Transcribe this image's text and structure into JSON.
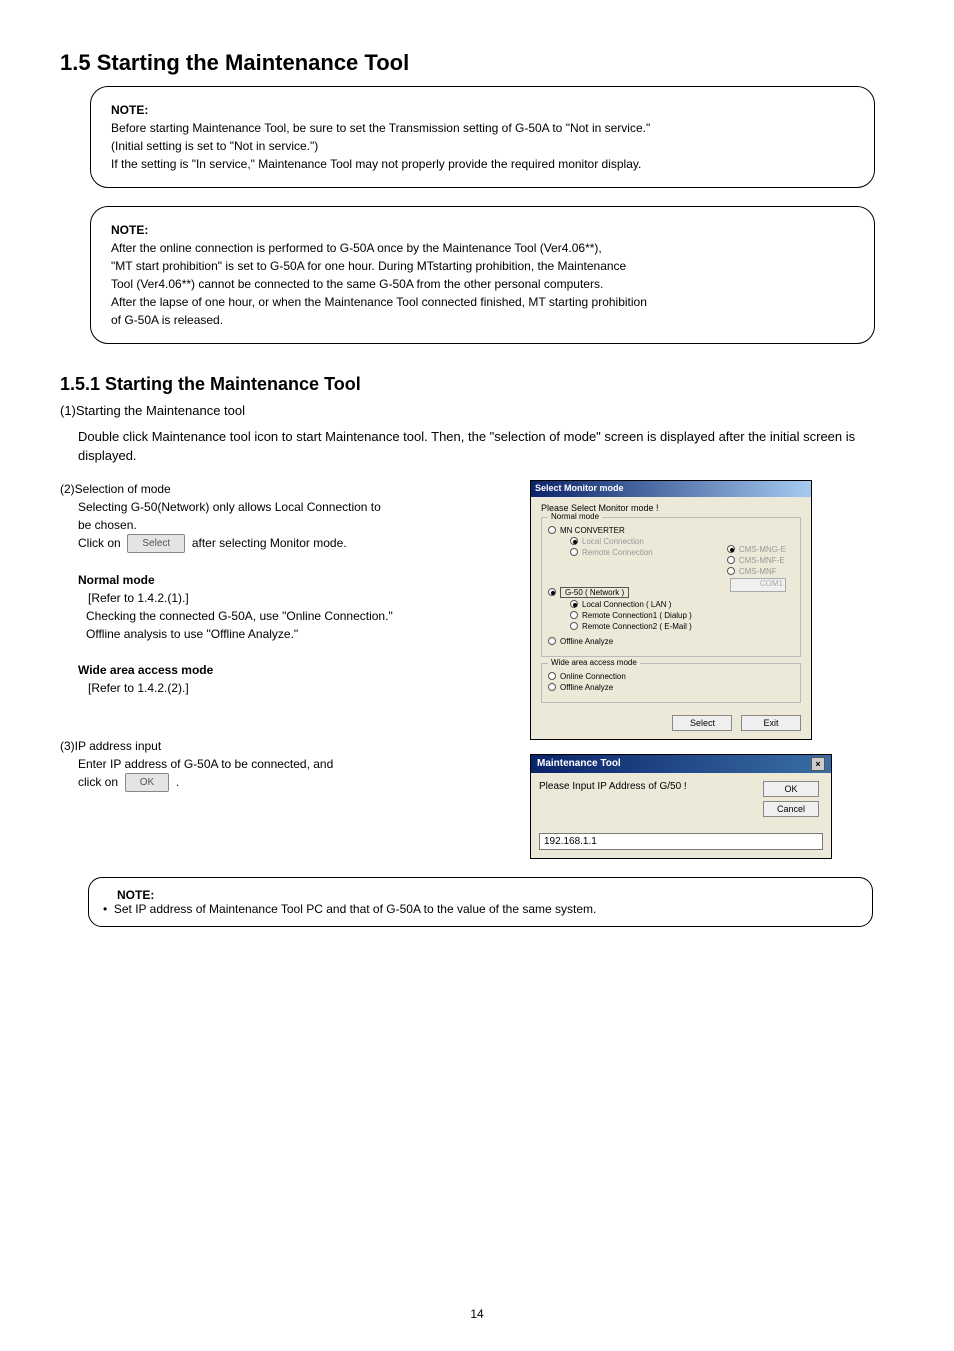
{
  "section_heading": "1.5 Starting the Maintenance Tool",
  "note1": {
    "title": "NOTE:",
    "lines": [
      "Before starting Maintenance Tool, be sure to set the Transmission setting of G-50A to \"Not in service.\"",
      "(Initial setting is set to \"Not in service.\")",
      "If the setting is \"In service,\" Maintenance Tool may not properly provide the required monitor display."
    ]
  },
  "note2": {
    "title": "NOTE:",
    "lines": [
      "After the online connection is performed to G-50A once by the Maintenance Tool (Ver4.06**),",
      "\"MT start prohibition\" is set to G-50A for one hour. During MTstarting prohibition, the Maintenance",
      "Tool (Ver4.06**) cannot be connected to the same G-50A from the other personal computers.",
      "After the lapse of one hour, or when the Maintenance Tool connected finished, MT starting prohibition",
      "of G-50A is released."
    ]
  },
  "sub_heading": "1.5.1 Starting the Maintenance Tool",
  "intro_line": "(1)Starting the Maintenance tool",
  "intro_text": "Double click Maintenance tool icon to start Maintenance tool. Then, the \"selection of mode\" screen is displayed after the initial screen is displayed.",
  "step2_heading": "(2)Selection of mode",
  "step2_lines": [
    "Selecting G-50(Network) only allows Local Connection to",
    "be chosen.",
    "Click on            after selecting Monitor mode."
  ],
  "select_label": "Select",
  "step2_bullets": [
    "Normal mode",
    "[Refer to 1.4.2.(1).]",
    "Wide area access mode",
    "[Refer to 1.4.2.(2).]"
  ],
  "bullet_sub": [
    "Checking the connected G-50A, use \"Online Connection.\"",
    "Offline analysis to use \"Offline Analyze.\""
  ],
  "step3_heading": "(3)IP address input",
  "step3_lines": [
    "Enter IP address of G-50A to be connected, and",
    "click on            ."
  ],
  "ok_label": "OK",
  "note3": {
    "title": "NOTE:",
    "line": "Set IP address of Maintenance Tool PC and that of G-50A to the value of the same system."
  },
  "dialog1": {
    "title": "Select Monitor mode",
    "prompt": "Please Select Monitor mode !",
    "fs_normal": "Normal mode",
    "mn_conv": "MN CONVERTER",
    "local_conn_gray": "Local Connection",
    "remote_conn_gray": "Remote Connection",
    "rhs1": "CMS-MNG-E",
    "rhs2": "CMS-MNF-E",
    "rhs3": "CMS-MNF",
    "combo": "COM1",
    "g50": "G-50 ( Network )",
    "g50_local": "Local Connection     ( LAN )",
    "g50_r1": "Remote Connection1 ( Dialup )",
    "g50_r2": "Remote Connection2 ( E-Mail )",
    "offline": "Offline Analyze",
    "fs_wide": "Wide area access mode",
    "wide_online": "Online Connection",
    "wide_offline": "Offline Analyze",
    "btn_select": "Select",
    "btn_exit": "Exit"
  },
  "dialog2": {
    "title": "Maintenance Tool",
    "prompt": "Please Input IP Address of G/50 !",
    "ok": "OK",
    "cancel": "Cancel",
    "ip": "192.168.1.1"
  },
  "page_num": "14"
}
